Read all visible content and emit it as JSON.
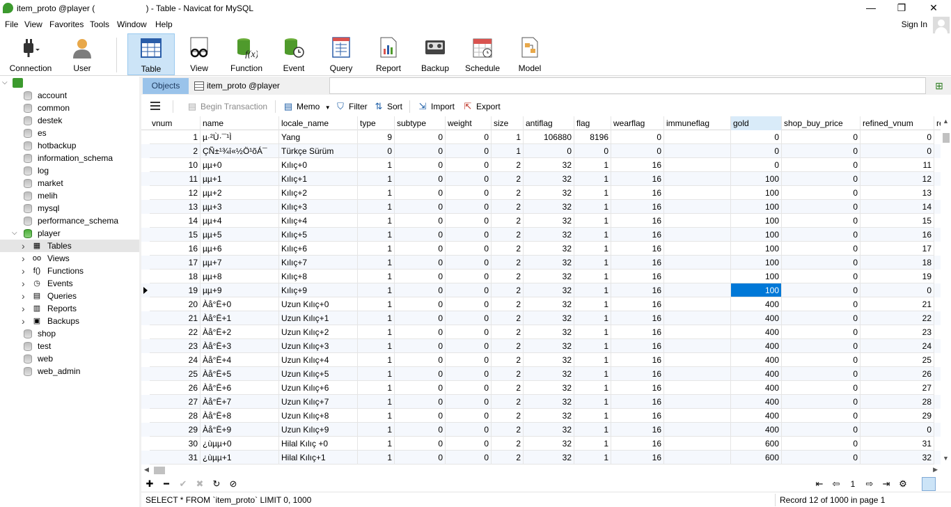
{
  "window": {
    "title": "item_proto @player (                      ) - Table - Navicat for MySQL",
    "min": "—",
    "max": "❐",
    "close": "✕"
  },
  "menu": [
    "File",
    "View",
    "Favorites",
    "Tools",
    "Window",
    "Help"
  ],
  "signin": "Sign In",
  "toolbar": [
    {
      "label": "Connection",
      "icon": "connection-icon"
    },
    {
      "label": "User",
      "icon": "user-icon"
    },
    {
      "label": "Table",
      "icon": "table-icon",
      "active": true
    },
    {
      "label": "View",
      "icon": "view-icon"
    },
    {
      "label": "Function",
      "icon": "function-icon"
    },
    {
      "label": "Event",
      "icon": "event-icon"
    },
    {
      "label": "Query",
      "icon": "query-icon"
    },
    {
      "label": "Report",
      "icon": "report-icon"
    },
    {
      "label": "Backup",
      "icon": "backup-icon"
    },
    {
      "label": "Schedule",
      "icon": "schedule-icon"
    },
    {
      "label": "Model",
      "icon": "model-icon"
    }
  ],
  "sidebar": {
    "databases": [
      "account",
      "common",
      "destek",
      "es",
      "hotbackup",
      "information_schema",
      "log",
      "market",
      "melih",
      "mysql",
      "performance_schema"
    ],
    "open_db": "player",
    "open_children": [
      {
        "label": "Tables",
        "icon": "table-icon"
      },
      {
        "label": "Views",
        "icon": "view-icon"
      },
      {
        "label": "Functions",
        "icon": "function-icon"
      },
      {
        "label": "Events",
        "icon": "event-icon"
      },
      {
        "label": "Queries",
        "icon": "query-icon"
      },
      {
        "label": "Reports",
        "icon": "report-icon"
      },
      {
        "label": "Backups",
        "icon": "backup-icon"
      }
    ],
    "after": [
      "shop",
      "test",
      "web",
      "web_admin"
    ]
  },
  "tabs": {
    "objects": "Objects",
    "item": "item_proto @player"
  },
  "actions": {
    "begin_transaction": "Begin Transaction",
    "memo": "Memo",
    "filter": "Filter",
    "sort": "Sort",
    "import": "Import",
    "export": "Export"
  },
  "grid": {
    "columns": [
      "vnum",
      "name",
      "locale_name",
      "type",
      "subtype",
      "weight",
      "size",
      "antiflag",
      "flag",
      "wearflag",
      "immuneflag",
      "gold",
      "shop_buy_price",
      "refined_vnum",
      "re"
    ],
    "rows": [
      [
        "1",
        "µ·²Ù·¯¹Ì",
        "Yang",
        "9",
        "0",
        "0",
        "1",
        "106880",
        "8196",
        "0",
        "",
        "0",
        "0",
        "0"
      ],
      [
        "2",
        "ÇÑ±¹¾î«½Ö¹õÁ¯",
        "Türkçe Sürüm",
        "0",
        "0",
        "0",
        "1",
        "0",
        "0",
        "0",
        "",
        "0",
        "0",
        "0"
      ],
      [
        "10",
        "µµ+0",
        "Kılıç+0",
        "1",
        "0",
        "0",
        "2",
        "32",
        "1",
        "16",
        "",
        "0",
        "0",
        "11"
      ],
      [
        "11",
        "µµ+1",
        "Kılıç+1",
        "1",
        "0",
        "0",
        "2",
        "32",
        "1",
        "16",
        "",
        "100",
        "0",
        "12"
      ],
      [
        "12",
        "µµ+2",
        "Kılıç+2",
        "1",
        "0",
        "0",
        "2",
        "32",
        "1",
        "16",
        "",
        "100",
        "0",
        "13"
      ],
      [
        "13",
        "µµ+3",
        "Kılıç+3",
        "1",
        "0",
        "0",
        "2",
        "32",
        "1",
        "16",
        "",
        "100",
        "0",
        "14"
      ],
      [
        "14",
        "µµ+4",
        "Kılıç+4",
        "1",
        "0",
        "0",
        "2",
        "32",
        "1",
        "16",
        "",
        "100",
        "0",
        "15"
      ],
      [
        "15",
        "µµ+5",
        "Kılıç+5",
        "1",
        "0",
        "0",
        "2",
        "32",
        "1",
        "16",
        "",
        "100",
        "0",
        "16"
      ],
      [
        "16",
        "µµ+6",
        "Kılıç+6",
        "1",
        "0",
        "0",
        "2",
        "32",
        "1",
        "16",
        "",
        "100",
        "0",
        "17"
      ],
      [
        "17",
        "µµ+7",
        "Kılıç+7",
        "1",
        "0",
        "0",
        "2",
        "32",
        "1",
        "16",
        "",
        "100",
        "0",
        "18"
      ],
      [
        "18",
        "µµ+8",
        "Kılıç+8",
        "1",
        "0",
        "0",
        "2",
        "32",
        "1",
        "16",
        "",
        "100",
        "0",
        "19"
      ],
      [
        "19",
        "µµ+9",
        "Kılıç+9",
        "1",
        "0",
        "0",
        "2",
        "32",
        "1",
        "16",
        "",
        "100",
        "0",
        "0"
      ],
      [
        "20",
        "Àå°Ë+0",
        "Uzun Kılıç+0",
        "1",
        "0",
        "0",
        "2",
        "32",
        "1",
        "16",
        "",
        "400",
        "0",
        "21"
      ],
      [
        "21",
        "Àå°Ë+1",
        "Uzun Kılıç+1",
        "1",
        "0",
        "0",
        "2",
        "32",
        "1",
        "16",
        "",
        "400",
        "0",
        "22"
      ],
      [
        "22",
        "Àå°Ë+2",
        "Uzun Kılıç+2",
        "1",
        "0",
        "0",
        "2",
        "32",
        "1",
        "16",
        "",
        "400",
        "0",
        "23"
      ],
      [
        "23",
        "Àå°Ë+3",
        "Uzun Kılıç+3",
        "1",
        "0",
        "0",
        "2",
        "32",
        "1",
        "16",
        "",
        "400",
        "0",
        "24"
      ],
      [
        "24",
        "Àå°Ë+4",
        "Uzun Kılıç+4",
        "1",
        "0",
        "0",
        "2",
        "32",
        "1",
        "16",
        "",
        "400",
        "0",
        "25"
      ],
      [
        "25",
        "Àå°Ë+5",
        "Uzun Kılıç+5",
        "1",
        "0",
        "0",
        "2",
        "32",
        "1",
        "16",
        "",
        "400",
        "0",
        "26"
      ],
      [
        "26",
        "Àå°Ë+6",
        "Uzun Kılıç+6",
        "1",
        "0",
        "0",
        "2",
        "32",
        "1",
        "16",
        "",
        "400",
        "0",
        "27"
      ],
      [
        "27",
        "Àå°Ë+7",
        "Uzun Kılıç+7",
        "1",
        "0",
        "0",
        "2",
        "32",
        "1",
        "16",
        "",
        "400",
        "0",
        "28"
      ],
      [
        "28",
        "Àå°Ë+8",
        "Uzun Kılıç+8",
        "1",
        "0",
        "0",
        "2",
        "32",
        "1",
        "16",
        "",
        "400",
        "0",
        "29"
      ],
      [
        "29",
        "Àå°Ë+9",
        "Uzun Kılıç+9",
        "1",
        "0",
        "0",
        "2",
        "32",
        "1",
        "16",
        "",
        "400",
        "0",
        "0"
      ],
      [
        "30",
        "¿ùµµ+0",
        "Hilal Kılıç +0",
        "1",
        "0",
        "0",
        "2",
        "32",
        "1",
        "16",
        "",
        "600",
        "0",
        "31"
      ],
      [
        "31",
        "¿ùµµ+1",
        "Hilal Kılıç+1",
        "1",
        "0",
        "0",
        "2",
        "32",
        "1",
        "16",
        "",
        "600",
        "0",
        "32"
      ]
    ],
    "current_row": 11,
    "selected_column": 11
  },
  "nav": {
    "page": "1"
  },
  "status": {
    "sql": "SELECT * FROM `item_proto` LIMIT 0, 1000",
    "record": "Record 12 of 1000 in page 1"
  }
}
